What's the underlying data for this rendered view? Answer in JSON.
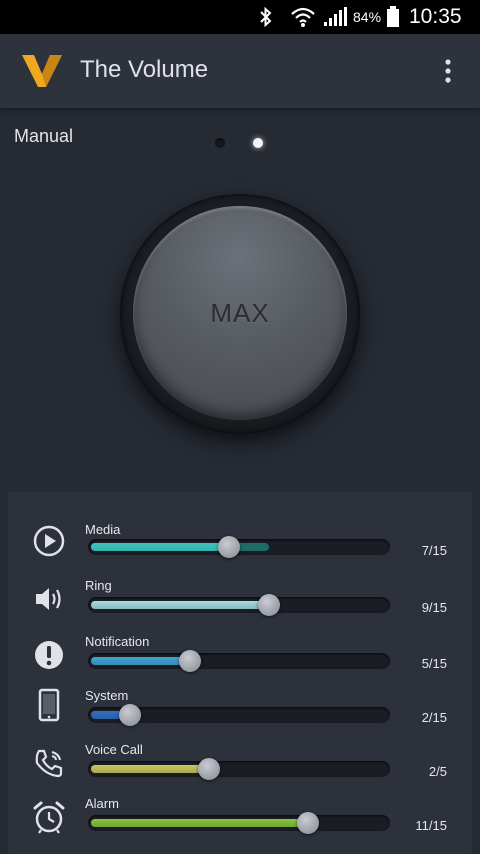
{
  "status_bar": {
    "battery_percent": "84%",
    "time": "10:35",
    "icons": [
      "bluetooth-icon",
      "wifi-icon",
      "signal-icon",
      "battery-icon"
    ]
  },
  "app_bar": {
    "title": "The Volume",
    "logo": "v-logo",
    "menu_icon": "overflow-menu-icon"
  },
  "mode": {
    "label": "Manual",
    "page_indicator": {
      "count": 2,
      "active": 2
    }
  },
  "knob": {
    "label": "MAX"
  },
  "channels": [
    {
      "icon": "play-icon",
      "label": "Media",
      "current": 7,
      "max": 15,
      "value_text": "7/15",
      "secondary": 0.6,
      "color": "#3cc4bd"
    },
    {
      "icon": "speaker-icon",
      "label": "Ring",
      "current": 9,
      "max": 15,
      "value_text": "9/15",
      "color": "#a6dce4"
    },
    {
      "icon": "alert-icon",
      "label": "Notification",
      "current": 5,
      "max": 15,
      "value_text": "5/15",
      "color": "#3fa6d8"
    },
    {
      "icon": "phone-device-icon",
      "label": "System",
      "current": 2,
      "max": 15,
      "value_text": "2/15",
      "color": "#2f6fc4"
    },
    {
      "icon": "phone-call-icon",
      "label": "Voice Call",
      "current": 2,
      "max": 5,
      "value_text": "2/5",
      "color": "#c9c95e"
    },
    {
      "icon": "alarm-clock-icon",
      "label": "Alarm",
      "current": 11,
      "max": 15,
      "value_text": "11/15",
      "color": "#86c63b"
    }
  ]
}
